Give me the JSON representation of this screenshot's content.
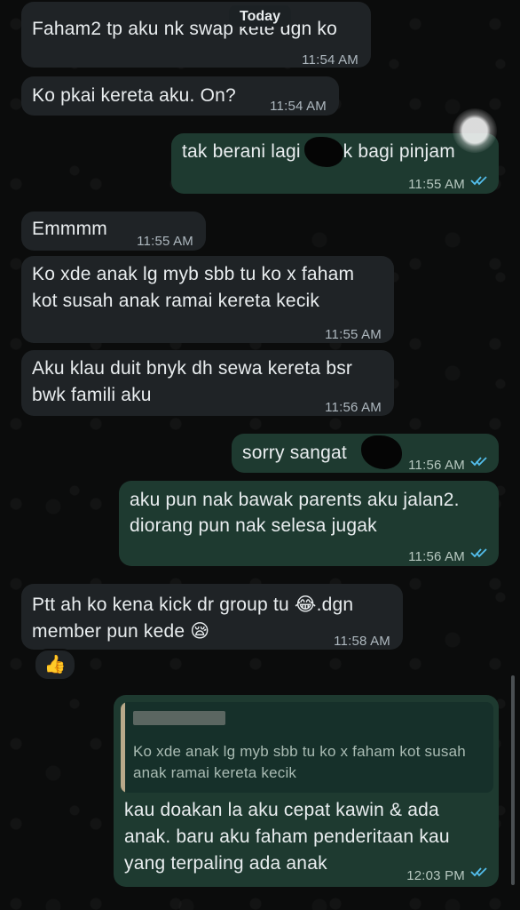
{
  "date_chip": "Today",
  "messages": [
    {
      "text": "Faham2 tp aku nk swap kete dgn ko",
      "time": "11:54 AM"
    },
    {
      "text": "Ko pkai kereta aku. On?",
      "time": "11:54 AM"
    },
    {
      "text": "tak berani lagi    nak bagi pinjam",
      "time": "11:55 AM"
    },
    {
      "text": "Emmmm",
      "time": "11:55 AM"
    },
    {
      "lines": [
        "Ko xde anak lg myb sbb tu ko x faham",
        "kot susah anak ramai kereta kecik"
      ],
      "time": "11:55 AM"
    },
    {
      "lines": [
        "Aku klau duit bnyk dh sewa kereta bsr",
        "bwk famili aku"
      ],
      "time": "11:56 AM"
    },
    {
      "text": "sorry sangat",
      "time": "11:56 AM"
    },
    {
      "lines": [
        "aku pun nak bawak parents aku jalan2.",
        "diorang pun nak selesa jugak"
      ],
      "time": "11:56 AM"
    },
    {
      "lines": [
        "Ptt ah ko kena kick dr group tu 😂.dgn",
        "member pun kede 😪"
      ],
      "time": "11:58 AM"
    },
    {
      "quote_lines": [
        "Ko xde anak lg myb sbb tu ko x faham kot susah",
        "anak ramai kereta kecik"
      ],
      "lines": [
        "kau doakan la aku cepat kawin & ada",
        "anak. baru aku faham penderitaan kau",
        "yang terpaling ada anak"
      ],
      "time": "12:03 PM"
    }
  ],
  "reaction": "👍",
  "colors": {
    "background": "#0b0c0c",
    "incoming_bubble": "#1f2326",
    "outgoing_bubble": "#1e3a30",
    "read_ticks": "#53bdeb"
  }
}
